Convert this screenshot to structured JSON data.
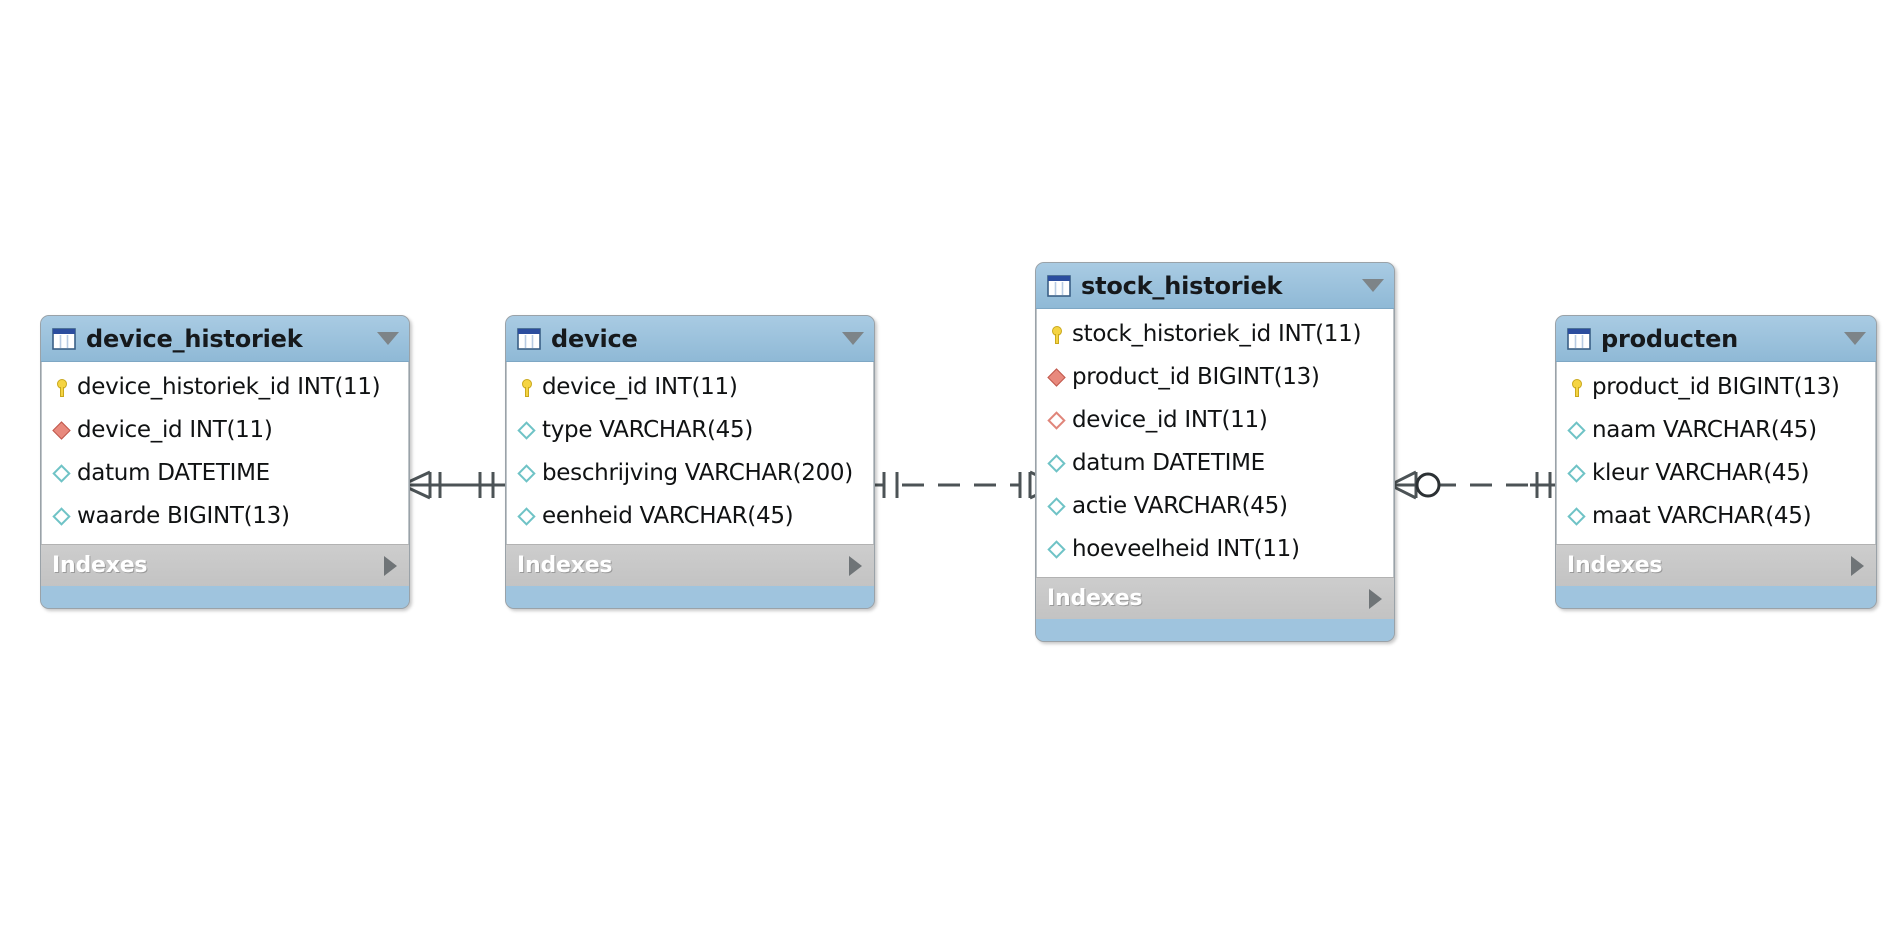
{
  "diagram": {
    "kind": "eer-diagram",
    "background": "#ffffff",
    "palette": {
      "header_blue": "#9fc4de",
      "body_white": "#ffffff",
      "indexes_gray": "#c6c6c6",
      "pk_yellow": "#f5d442",
      "fk_red": "#e8897d",
      "column_teal": "#6fc3c6",
      "connector_gray": "#4c5356"
    },
    "indexes_label": "Indexes",
    "tables": [
      {
        "id": "device_historiek",
        "name": "device_historiek",
        "icon": "table-icon",
        "menu_icon": "chevron-down-icon",
        "expand_icon": "chevron-right-icon",
        "columns": [
          {
            "icon": "primary-key-icon",
            "kind": "pk",
            "text": "device_historiek_id INT(11)"
          },
          {
            "icon": "foreign-key-icon",
            "kind": "fk",
            "text": "device_id INT(11)"
          },
          {
            "icon": "column-icon",
            "kind": "column",
            "text": "datum DATETIME"
          },
          {
            "icon": "column-icon",
            "kind": "column",
            "text": "waarde BIGINT(13)"
          }
        ]
      },
      {
        "id": "device",
        "name": "device",
        "icon": "table-icon",
        "menu_icon": "chevron-down-icon",
        "expand_icon": "chevron-right-icon",
        "columns": [
          {
            "icon": "primary-key-icon",
            "kind": "pk",
            "text": "device_id INT(11)"
          },
          {
            "icon": "column-icon",
            "kind": "column",
            "text": "type VARCHAR(45)"
          },
          {
            "icon": "column-icon",
            "kind": "column",
            "text": "beschrijving VARCHAR(200)"
          },
          {
            "icon": "column-icon",
            "kind": "column",
            "text": "eenheid VARCHAR(45)"
          }
        ]
      },
      {
        "id": "stock_historiek",
        "name": "stock_historiek",
        "icon": "table-icon",
        "menu_icon": "chevron-down-icon",
        "expand_icon": "chevron-right-icon",
        "columns": [
          {
            "icon": "primary-key-icon",
            "kind": "pk",
            "text": "stock_historiek_id INT(11)"
          },
          {
            "icon": "foreign-key-icon",
            "kind": "fk",
            "text": "product_id BIGINT(13)"
          },
          {
            "icon": "foreign-key-null-icon",
            "kind": "fk-null",
            "text": "device_id INT(11)"
          },
          {
            "icon": "column-icon",
            "kind": "column",
            "text": "datum DATETIME"
          },
          {
            "icon": "column-icon",
            "kind": "column",
            "text": "actie VARCHAR(45)"
          },
          {
            "icon": "column-icon",
            "kind": "column",
            "text": "hoeveelheid INT(11)"
          }
        ]
      },
      {
        "id": "producten",
        "name": "producten",
        "icon": "table-icon",
        "menu_icon": "chevron-down-icon",
        "expand_icon": "chevron-right-icon",
        "columns": [
          {
            "icon": "primary-key-icon",
            "kind": "pk",
            "text": "product_id BIGINT(13)"
          },
          {
            "icon": "column-icon",
            "kind": "column",
            "text": "naam VARCHAR(45)"
          },
          {
            "icon": "column-icon",
            "kind": "column",
            "text": "kleur VARCHAR(45)"
          },
          {
            "icon": "column-icon",
            "kind": "column",
            "text": "maat VARCHAR(45)"
          }
        ]
      }
    ],
    "relationships": [
      {
        "id": "rel-device-historiek-device",
        "from_table": "device_historiek",
        "to_table": "device",
        "from_cardinality": "many",
        "to_cardinality": "one",
        "line_style": "solid",
        "type": "identifying"
      },
      {
        "id": "rel-device-stock-historiek",
        "from_table": "device",
        "to_table": "stock_historiek",
        "from_cardinality": "one",
        "to_cardinality": "many",
        "line_style": "dashed",
        "type": "non-identifying"
      },
      {
        "id": "rel-stock-historiek-producten",
        "from_table": "stock_historiek",
        "to_table": "producten",
        "from_cardinality": "zero-or-many",
        "to_cardinality": "one",
        "line_style": "dashed",
        "type": "non-identifying"
      }
    ]
  }
}
